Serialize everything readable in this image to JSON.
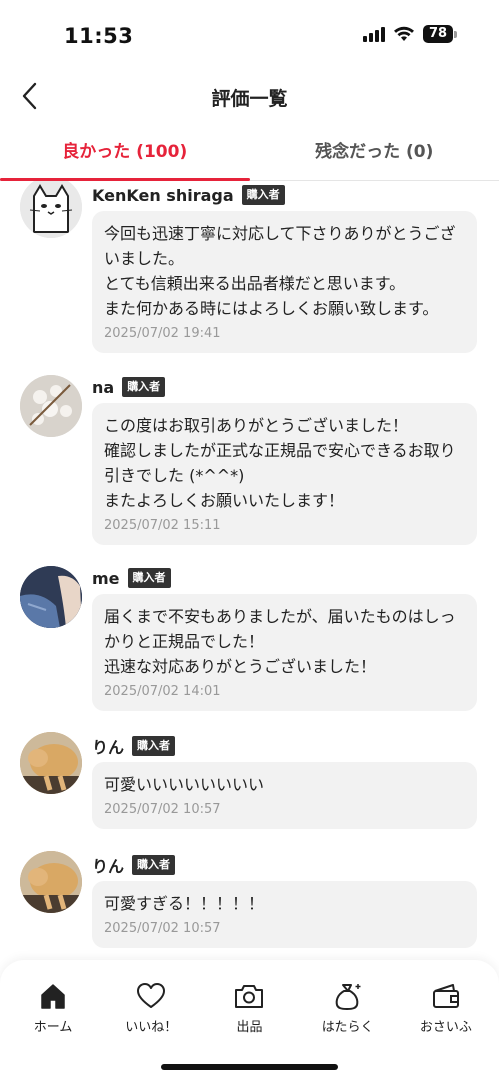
{
  "status_bar": {
    "time": "11:53",
    "battery": "78"
  },
  "header": {
    "title": "評価一覧"
  },
  "tabs": [
    {
      "label": "良かった (100)",
      "active": true
    },
    {
      "label": "残念だった (0)",
      "active": false
    }
  ],
  "badge_label": "購入者",
  "reviews": [
    {
      "name": "KenKen shiraga",
      "comment": "今回も迅速丁寧に対応して下さりありがとうございました。\nとても信頼出来る出品者様だと思います。\nまた何かある時にはよろしくお願い致します。",
      "date": "2025/07/02 19:41",
      "avatar": "cat-cartoon"
    },
    {
      "name": "na",
      "comment": "この度はお取引ありがとうございました！\n確認しましたが正式な正規品で安心できるお取り引きでした (*^^*)\nまたよろしくお願いいたします！",
      "date": "2025/07/02 15:11",
      "avatar": "cotton-flowers"
    },
    {
      "name": "me",
      "comment": "届くまで不安もありましたが、届いたものはしっかりと正規品でした！\n迅速な対応ありがとうございました！",
      "date": "2025/07/02 14:01",
      "avatar": "jeans-photo"
    },
    {
      "name": "りん",
      "comment": "可愛いいいいいいいい",
      "date": "2025/07/02 10:57",
      "avatar": "cat-photo"
    },
    {
      "name": "りん",
      "comment": "可愛すぎる！！！！！",
      "date": "2025/07/02 10:57",
      "avatar": "cat-photo"
    }
  ],
  "bottom_nav": [
    {
      "label": "ホーム",
      "icon": "home-icon"
    },
    {
      "label": "いいね！",
      "icon": "heart-icon"
    },
    {
      "label": "出品",
      "icon": "camera-icon"
    },
    {
      "label": "はたらく",
      "icon": "money-bag-icon"
    },
    {
      "label": "おさいふ",
      "icon": "wallet-icon"
    }
  ]
}
